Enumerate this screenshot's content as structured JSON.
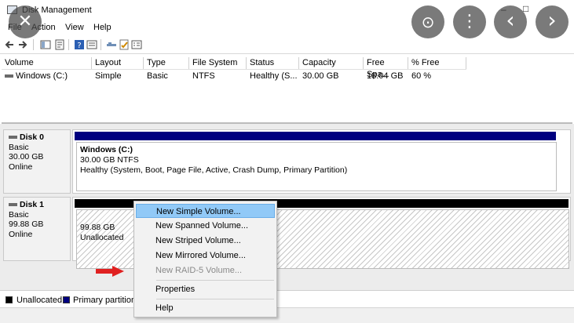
{
  "window": {
    "title": "Disk Management",
    "min": "–",
    "max": "□"
  },
  "menu": [
    "File",
    "Action",
    "View",
    "Help"
  ],
  "volume_table": {
    "columns": [
      "Volume",
      "Layout",
      "Type",
      "File System",
      "Status",
      "Capacity",
      "Free Spa...",
      "% Free"
    ],
    "rows": [
      [
        "Windows (C:)",
        "Simple",
        "Basic",
        "NTFS",
        "Healthy (S...",
        "30.00 GB",
        "18.04 GB",
        "60 %"
      ]
    ]
  },
  "disks": [
    {
      "name": "Disk 0",
      "type": "Basic",
      "size": "30.00 GB",
      "status": "Online",
      "partition": {
        "name": "Windows  (C:)",
        "size": "30.00 GB NTFS",
        "status": "Healthy (System, Boot, Page File, Active, Crash Dump, Primary Partition)",
        "color": "#00007f"
      }
    },
    {
      "name": "Disk 1",
      "type": "Basic",
      "size": "99.88 GB",
      "status": "Online",
      "partition": {
        "size": "99.88 GB",
        "status": "Unallocated",
        "color": "#000000"
      }
    }
  ],
  "context_menu": {
    "items": [
      "New Simple Volume...",
      "New Spanned Volume...",
      "New Striped Volume...",
      "New Mirrored Volume...",
      "New RAID-5 Volume...",
      "Properties",
      "Help"
    ],
    "highlighted": "New Simple Volume...",
    "disabled": "New RAID-5 Volume..."
  },
  "legend": [
    {
      "label": "Unallocated",
      "color": "#000000"
    },
    {
      "label": "Primary partition",
      "color": "#00007f"
    }
  ],
  "overlay_buttons": [
    {
      "icon": "close-icon",
      "glyph": "✕"
    },
    {
      "icon": "lens-icon",
      "glyph": "⊙"
    },
    {
      "icon": "more-vert-icon",
      "glyph": "⋮"
    },
    {
      "icon": "chevron-left-icon",
      "glyph": "‹"
    },
    {
      "icon": "chevron-right-icon",
      "glyph": "›"
    }
  ],
  "annotation_arrow_color": "#e02020"
}
